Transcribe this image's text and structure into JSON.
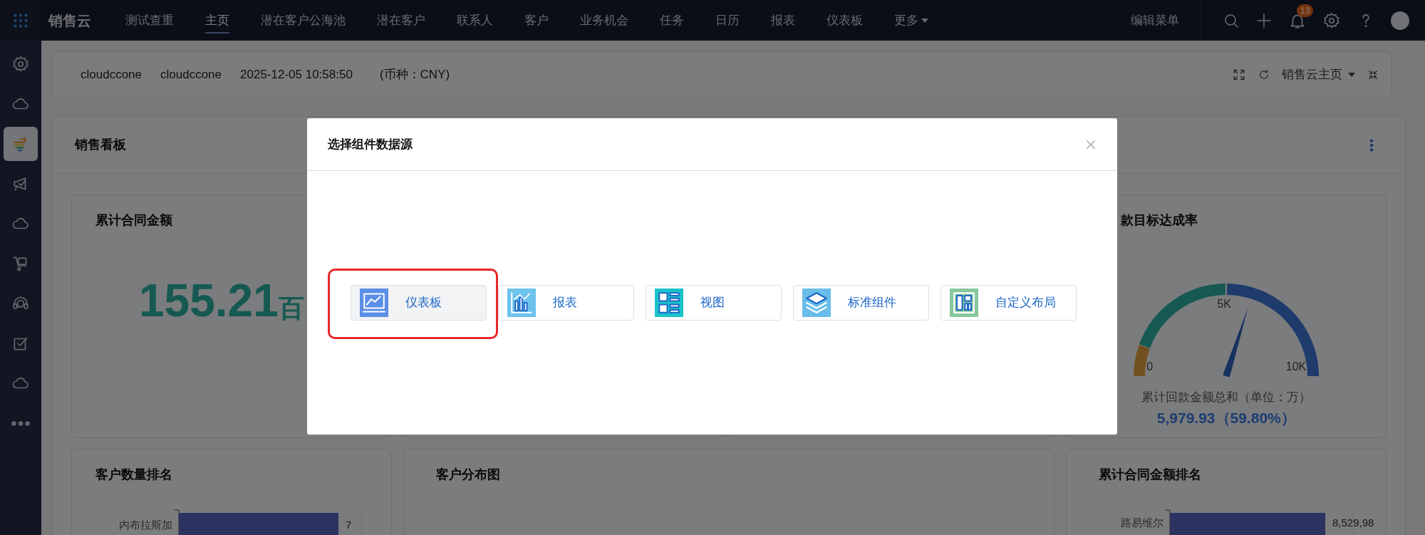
{
  "top_nav": {
    "logo": "销售云",
    "items": [
      {
        "label": "测试查重",
        "selected": false
      },
      {
        "label": "主页",
        "selected": true
      },
      {
        "label": "潜在客户公海池",
        "selected": false
      },
      {
        "label": "潜在客户",
        "selected": false
      },
      {
        "label": "联系人",
        "selected": false
      },
      {
        "label": "客户",
        "selected": false
      },
      {
        "label": "业务机会",
        "selected": false
      },
      {
        "label": "任务",
        "selected": false
      },
      {
        "label": "日历",
        "selected": false
      },
      {
        "label": "报表",
        "selected": false
      },
      {
        "label": "仪表板",
        "selected": false
      },
      {
        "label": "更多",
        "selected": false,
        "kind": "dropdown"
      }
    ],
    "edit_menu": "编辑菜单",
    "notification_count": "13"
  },
  "sidebar": {
    "items": [
      {
        "kind": "gear",
        "selected": false
      },
      {
        "kind": "cloud",
        "selected": false
      },
      {
        "kind": "trend",
        "selected": true
      },
      {
        "kind": "megaphone",
        "selected": false
      },
      {
        "kind": "cloud",
        "selected": false
      },
      {
        "kind": "cart",
        "selected": false
      },
      {
        "kind": "headset",
        "selected": false
      },
      {
        "kind": "checklist",
        "selected": false
      },
      {
        "kind": "cloud",
        "selected": false
      },
      {
        "kind": "more",
        "selected": false
      }
    ]
  },
  "header": {
    "texts": [
      "cloudccone",
      "cloudccone",
      "2025-12-05 10:58:50",
      "(币种：CNY)"
    ],
    "home_selector": "销售云主页"
  },
  "dashboard": {
    "title": "销售看板",
    "widgets": [
      {
        "kind": "metric",
        "title": "累计合同金额",
        "value": "155.21",
        "unit": "百"
      },
      {
        "kind": "covered"
      },
      {
        "kind": "covered"
      },
      {
        "kind": "gauge",
        "title": "款目标达成率",
        "ticks": [
          "0",
          "5K",
          "10K"
        ],
        "caption": "累计回款金额总和（单位：万）",
        "value": "5,979.93（59.80%）"
      },
      {
        "kind": "bar",
        "title": "客户数量排名",
        "chart_data": {
          "type": "bar",
          "orientation": "horizontal",
          "categories": [
            "内布拉斯加"
          ],
          "values": [
            7
          ],
          "value_labels": [
            "7"
          ]
        }
      },
      {
        "kind": "map",
        "title": "客户分布图"
      },
      {
        "kind": "ranking",
        "title": "累计合同金额排名",
        "category": "路易维尔",
        "value_label": "8,529,98"
      }
    ]
  },
  "modal": {
    "title": "选择组件数据源",
    "options": [
      {
        "label": "仪表板",
        "kind": "dashboard",
        "selected": true,
        "highlighted": true
      },
      {
        "label": "报表",
        "kind": "report",
        "selected": false,
        "highlighted": false
      },
      {
        "label": "视图",
        "kind": "view",
        "selected": false,
        "highlighted": false
      },
      {
        "label": "标准组件",
        "kind": "standard",
        "selected": false,
        "highlighted": false
      },
      {
        "label": "自定义布局",
        "kind": "custom",
        "selected": false,
        "highlighted": false
      }
    ]
  }
}
